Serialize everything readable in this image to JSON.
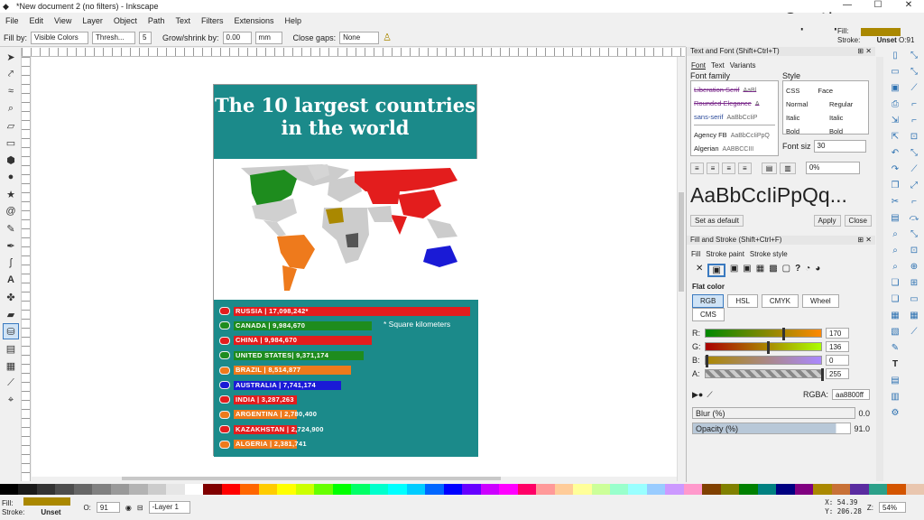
{
  "window": {
    "title": "*New document 2 (no filters) - Inkscape",
    "minimize": "—",
    "maximize": "☐",
    "close": "✕"
  },
  "watermark": "©pctips.com",
  "menubar": [
    "File",
    "Edit",
    "View",
    "Layer",
    "Object",
    "Path",
    "Text",
    "Filters",
    "Extensions",
    "Help"
  ],
  "toolctrl": {
    "fill_by_label": "Fill by:",
    "fill_by_value": "Visible Colors",
    "threshold_value": "Thresh...",
    "threshold_num": "5",
    "grow_label": "Grow/shrink by:",
    "grow_value": "0.00",
    "grow_unit": "mm",
    "gaps_label": "Close gaps:",
    "gaps_value": "None"
  },
  "fill_indicator": {
    "fill_label": "Fill:",
    "stroke_label": "Stroke:",
    "stroke_value": "Unset",
    "opacity_label": "O:",
    "opacity_value": "91",
    "fill_color": "#aa8800"
  },
  "poster": {
    "title_line1": "The 10 largest countries",
    "title_line2": "in the world",
    "footnote": "* Square kilometers",
    "bg_color": "#1b8a8a",
    "bars": [
      {
        "label": "RUSSIA | 17,098,242*",
        "value": 17098242,
        "color": "#e31d1d"
      },
      {
        "label": "CANADA | 9,984,670",
        "value": 9984670,
        "color": "#1e8c1e"
      },
      {
        "label": "CHINA | 9,984,670",
        "value": 9984670,
        "color": "#e31d1d"
      },
      {
        "label": "UNITED STATES| 9,371,174",
        "value": 9371174,
        "color": "#1e8c1e"
      },
      {
        "label": "BRAZIL | 8,514,877",
        "value": 8514877,
        "color": "#ee7a1c"
      },
      {
        "label": "AUSTRALIA | 7,741,174",
        "value": 7741174,
        "color": "#1a1ad6"
      },
      {
        "label": "INDIA | 3,287,263",
        "value": 3287263,
        "color": "#e31d1d"
      },
      {
        "label": "ARGENTINA | 2,780,400",
        "value": 2780400,
        "color": "#ee7a1c"
      },
      {
        "label": "KAZAKHSTAN | 2,724,900",
        "value": 2724900,
        "color": "#e31d1d"
      },
      {
        "label": "ALGERIA | 2,381,741",
        "value": 2381741,
        "color": "#ee7a1c"
      }
    ]
  },
  "text_font": {
    "header": "Text and Font (Shift+Ctrl+T)",
    "tabs": [
      "Font",
      "Text",
      "Variants"
    ],
    "family_label": "Font family",
    "families": [
      {
        "name": "Liberation Serif",
        "preview": "AaBl"
      },
      {
        "name": "Rounded Elegance",
        "preview": "A"
      },
      {
        "name": "sans-serif",
        "preview": "AaBbCcIiP"
      },
      {
        "name": "Agency FB",
        "preview": "AaBbCcIiPpQ"
      },
      {
        "name": "Algerian",
        "preview": "AABBCCIII"
      }
    ],
    "style_label": "Style",
    "style_cols": [
      "CSS",
      "Face"
    ],
    "styles": [
      [
        "Normal",
        "Regular"
      ],
      [
        "Italic",
        "Italic"
      ],
      [
        "Bold",
        "Bold"
      ]
    ],
    "size_label": "Font siz",
    "size_value": "30",
    "spacing_value": "0%",
    "preview": "AaBbCcIiPpQq...",
    "set_default": "Set as default",
    "apply": "Apply",
    "close": "Close"
  },
  "fill_stroke": {
    "header": "Fill and Stroke (Shift+Ctrl+F)",
    "tabs": [
      "Fill",
      "Stroke paint",
      "Stroke style"
    ],
    "flat_color": "Flat color",
    "modes": [
      "RGB",
      "HSL",
      "CMYK",
      "Wheel",
      "CMS"
    ],
    "channels": [
      {
        "label": "R:",
        "value": "170"
      },
      {
        "label": "G:",
        "value": "136"
      },
      {
        "label": "B:",
        "value": "0"
      },
      {
        "label": "A:",
        "value": "255"
      }
    ],
    "rgba_label": "RGBA:",
    "rgba_value": "aa8800ff",
    "blur_label": "Blur (%)",
    "blur_value": "0.0",
    "opacity_label": "Opacity (%)",
    "opacity_value": "91.0"
  },
  "statusbar": {
    "fill_label": "Fill:",
    "stroke_label": "Stroke:",
    "stroke_value": "Unset",
    "o_label": "O:",
    "o_value": "91",
    "layer": "-Layer 1",
    "x_label": "X:",
    "x_value": "54.39",
    "y_label": "Y:",
    "y_value": "206.28",
    "zoom_label": "Z:",
    "zoom_value": "54%"
  },
  "palette": [
    "#000000",
    "#1a1a1a",
    "#333333",
    "#4d4d4d",
    "#666666",
    "#808080",
    "#999999",
    "#b3b3b3",
    "#cccccc",
    "#e6e6e6",
    "#ffffff",
    "#800000",
    "#ff0000",
    "#ff6600",
    "#ffcc00",
    "#ffff00",
    "#ccff00",
    "#66ff00",
    "#00ff00",
    "#00ff66",
    "#00ffcc",
    "#00ffff",
    "#00ccff",
    "#0066ff",
    "#0000ff",
    "#6600ff",
    "#cc00ff",
    "#ff00ff",
    "#ff0066",
    "#ff9999",
    "#ffcc99",
    "#ffff99",
    "#ccff99",
    "#99ffcc",
    "#99ffff",
    "#99ccff",
    "#cc99ff",
    "#ff99cc",
    "#804000",
    "#808000",
    "#008000",
    "#008080",
    "#000080",
    "#800080",
    "#aa8800",
    "#c87137",
    "#5a2ca0",
    "#2ca089",
    "#d45500",
    "#e9c6af"
  ]
}
